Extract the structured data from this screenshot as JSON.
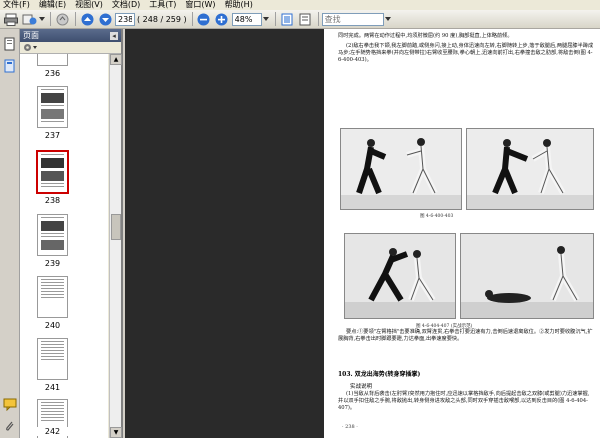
{
  "menubar": {
    "items": [
      "文件(F)",
      "编辑(E)",
      "视图(V)",
      "文档(D)",
      "工具(T)",
      "窗口(W)",
      "帮助(H)"
    ]
  },
  "toolbar": {
    "page_number": "238",
    "page_count": "( 248 / 259 )",
    "zoom": "48%",
    "search_placeholder": "查找"
  },
  "nav": {
    "header_label": "页面",
    "thumbnails": [
      {
        "label": "236",
        "selected": false
      },
      {
        "label": "237",
        "selected": false
      },
      {
        "label": "238",
        "selected": true
      },
      {
        "label": "239",
        "selected": false
      },
      {
        "label": "240",
        "selected": false
      },
      {
        "label": "241",
        "selected": false
      },
      {
        "label": "242",
        "selected": false
      }
    ]
  },
  "document": {
    "para1": "同时完成。两臂在动作过程中,均须肘微屈(约 90 度),胸部挺直,上体略前倾。",
    "para2": "(2)敌右拳击我下颌,我左脚前踏,或侧身闪,接上动,身体迅速向左转,右脚随转上步,落于敌腿后,两腿屈膝半蹲成马步;左手随势格挡来拳(并向左侧带拉)右臂收至腰际,拳心朝上,迅速向前打出,右拳撞击敌之肋部,将敌击倒(图 4-6-400-403)。",
    "caption_top": "图 4-6-400-403",
    "caption_bottom": "图 4-6-404-407 (实战示范)",
    "para3": "要点:①要领\"左臂格挡\"击要准确,双臂连贯,右拳击打要迅速有力,击倒后速退离敌位。②发力时要收腹沉气,扩展胸背,右拳击出时脚跟要蹬,力达拳面,出拳速度要快。",
    "section_title": "103. 双龙出海势(转身穿插掌)",
    "sub_title": "实战说明",
    "para4": "(1)当敌从背后袭击(左肘臂)突然用力抱住时,应迅速以掌格挡敌手,向后提起击敌之双膝(或剪腿)力迅速掌握,并以双手扣住敌之手腕,将敌抛出,转身侧身进攻敌之头部,同时双手穿插击敌喉部,以达到反击目的(图 4-6-404-407)。",
    "page_footer": "· 238 ·"
  }
}
